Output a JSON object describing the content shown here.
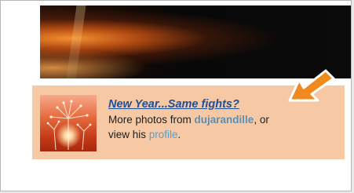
{
  "caption": {
    "title": "New Year...Same fights?",
    "line_prefix": "More photos from ",
    "username": "dujarandille",
    "mid_text": ", or",
    "line2_prefix": "view his ",
    "profile_link": "profile",
    "line2_suffix": "."
  },
  "icons": {
    "arrow": "orange-pointer-arrow-icon",
    "thumbnail": "dandelion-thumbnail"
  },
  "colors": {
    "caption_background": "#f6c9a4",
    "title_link": "#1f4f9a",
    "username_link": "#5a8fb5",
    "profile_link": "#5a9fc8",
    "arrow": "#f08a1e"
  }
}
